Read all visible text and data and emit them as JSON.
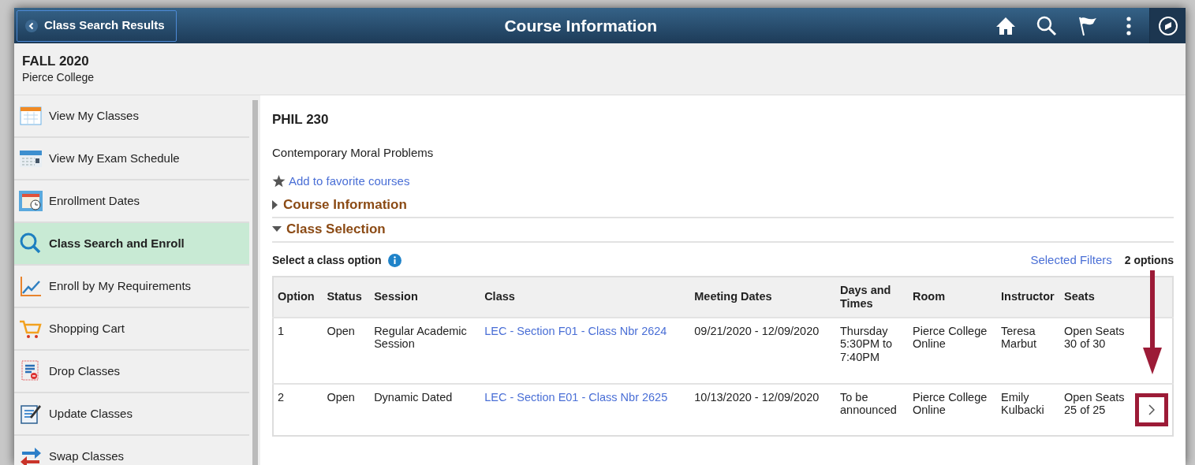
{
  "header": {
    "back_button": "Class Search Results",
    "title": "Course Information"
  },
  "term": {
    "name": "FALL 2020",
    "institution": "Pierce College"
  },
  "sidebar": {
    "items": [
      {
        "label": "View My Classes",
        "selected": false
      },
      {
        "label": "View My Exam Schedule",
        "selected": false
      },
      {
        "label": "Enrollment Dates",
        "selected": false
      },
      {
        "label": "Class Search and Enroll",
        "selected": true
      },
      {
        "label": "Enroll by My Requirements",
        "selected": false
      },
      {
        "label": "Shopping Cart",
        "selected": false
      },
      {
        "label": "Drop Classes",
        "selected": false
      },
      {
        "label": "Update Classes",
        "selected": false
      },
      {
        "label": "Swap Classes",
        "selected": false
      }
    ]
  },
  "course": {
    "code": "PHIL 230",
    "title": "Contemporary Moral Problems",
    "favorite_link": "Add to favorite courses",
    "sections": [
      {
        "label": "Course Information",
        "expanded": false
      },
      {
        "label": "Class Selection",
        "expanded": true
      }
    ]
  },
  "class_selection": {
    "prompt": "Select a class option",
    "filters_link": "Selected Filters",
    "count": "2 options",
    "table": {
      "columns": [
        "Option",
        "Status",
        "Session",
        "Class",
        "Meeting Dates",
        "Days and Times",
        "Room",
        "Instructor",
        "Seats"
      ],
      "rows": [
        {
          "cells": [
            "1",
            "Open",
            "Regular Academic Session",
            "LEC - Section F01 - Class Nbr 2624",
            "09/21/2020 - 12/09/2020",
            "Thursday 5:30PM to 7:40PM",
            "Pierce College Online",
            "Teresa Marbut",
            "Open Seats 30 of 30"
          ],
          "highlighted": false
        },
        {
          "cells": [
            "2",
            "Open",
            "Dynamic Dated",
            "LEC - Section E01 - Class Nbr 2625",
            "10/13/2020 - 12/09/2020",
            "To be announced",
            "Pierce College Online",
            "Emily Kulbacki",
            "Open Seats 25 of 25"
          ],
          "highlighted": true
        }
      ]
    }
  }
}
